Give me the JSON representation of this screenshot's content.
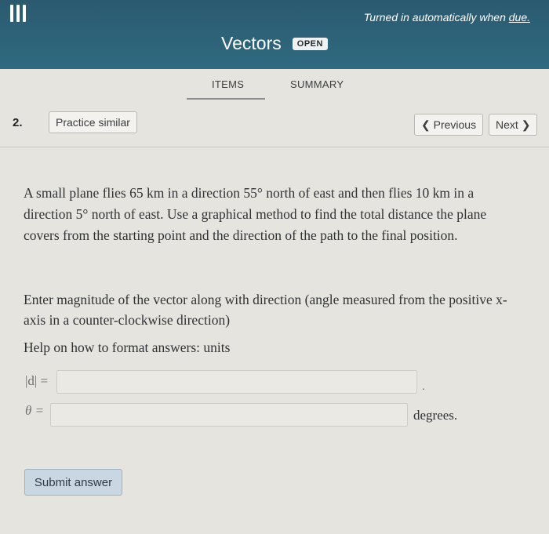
{
  "header": {
    "title": "Vectors",
    "badge": "OPEN",
    "auto_note_prefix": "Turned in automatically when ",
    "auto_note_link": "due."
  },
  "tabs": [
    {
      "label": "ITEMS"
    },
    {
      "label": "SUMMARY"
    }
  ],
  "question_bar": {
    "number": "2.",
    "practice_label": "Practice similar",
    "prev_label": "Previous",
    "next_label": "Next"
  },
  "question": {
    "text": "A small plane flies 65 km in a direction 55° north of east and then flies 10 km in a direction 5° north of east. Use a graphical method to find the total distance the plane covers from the starting point and the direction of the path to the final position.",
    "instruction": "Enter magnitude of the vector along with direction (angle measured from the positive x-axis in a counter-clockwise direction)",
    "help": "Help on how to format answers: units"
  },
  "answers": {
    "magnitude_label": "|d| =",
    "magnitude_value": "",
    "angle_label": "θ =",
    "angle_value": "",
    "angle_unit": "degrees.",
    "after_magnitude": "."
  },
  "submit_label": "Submit answer"
}
